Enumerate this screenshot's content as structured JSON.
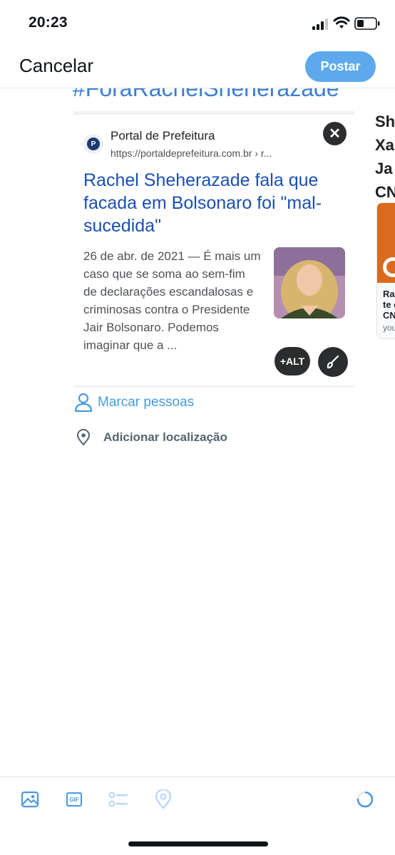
{
  "status": {
    "time": "20:23"
  },
  "header": {
    "cancel_label": "Cancelar",
    "post_label": "Postar"
  },
  "tweet": {
    "hashtag": "#ForaRachelSheherazade"
  },
  "card": {
    "site_name": "Portal de Prefeitura",
    "url": "https://portaldeprefeitura.com.br › r...",
    "favicon_letter": "P",
    "headline": "Rachel Sheherazade fala que facada em Bolsonaro foi \"mal-sucedida\"",
    "snippet": "26 de abr. de 2021 — É mais um caso que se soma ao sem-fim de declarações escandalosas e criminosas contra o Presidente Jair Bolsonaro. Podemos imaginar que a ...",
    "alt_label": "+ALT"
  },
  "peek": {
    "title_lines": [
      "Sh",
      "Xa",
      "Ja",
      "CN"
    ],
    "text_lines": [
      "Ra",
      "te c",
      "CN"
    ],
    "source": "you"
  },
  "actions": {
    "tag_people": "Marcar pessoas",
    "add_location": "Adicionar localização"
  },
  "toolbar": {
    "gif_label": "GIF"
  },
  "colors": {
    "accent": "#4a98e0",
    "post_button": "#5ea9ec",
    "link": "#1a4fb4"
  }
}
